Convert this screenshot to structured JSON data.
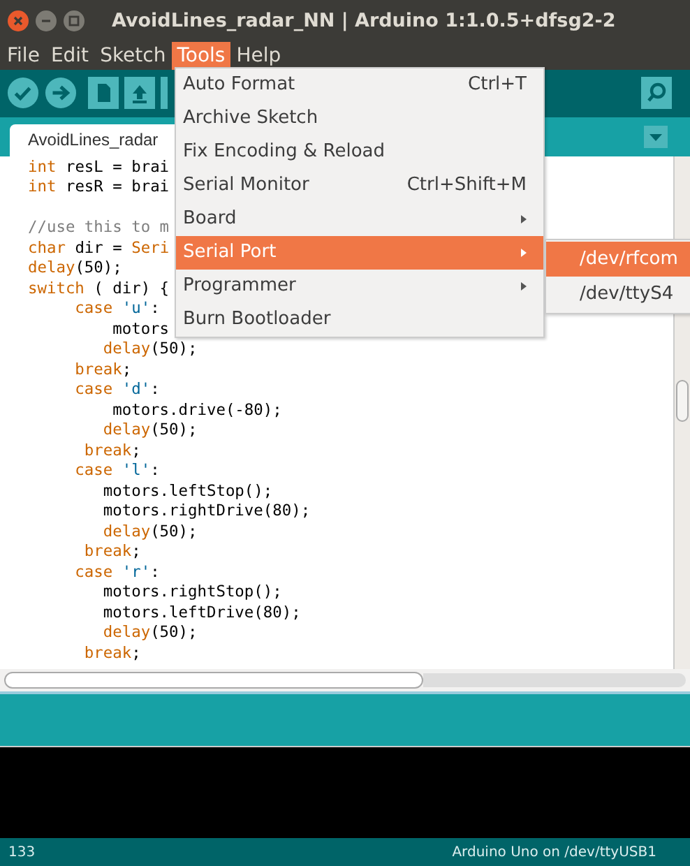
{
  "window": {
    "title": "AvoidLines_radar_NN | Arduino 1:1.0.5+dfsg2-2"
  },
  "menubar": [
    {
      "label": "File",
      "selected": false
    },
    {
      "label": "Edit",
      "selected": false
    },
    {
      "label": "Sketch",
      "selected": false
    },
    {
      "label": "Tools",
      "selected": true
    },
    {
      "label": "Help",
      "selected": false
    }
  ],
  "tabs": [
    {
      "label": "AvoidLines_radar",
      "selected": true
    }
  ],
  "editor": {
    "lines": [
      [
        {
          "kind": "keyword",
          "text": "int"
        },
        {
          "kind": "plain",
          "text": " resL = brai"
        }
      ],
      [
        {
          "kind": "keyword",
          "text": "int"
        },
        {
          "kind": "plain",
          "text": " resR = brai"
        }
      ],
      [
        {
          "kind": "blank"
        }
      ],
      [
        {
          "kind": "comment",
          "text": "//use this to m"
        }
      ],
      [
        {
          "kind": "keyword",
          "text": "char"
        },
        {
          "kind": "plain",
          "text": " dir = "
        },
        {
          "kind": "keyword",
          "text": "Seri"
        }
      ],
      [
        {
          "kind": "keyword",
          "text": "delay"
        },
        {
          "kind": "plain",
          "text": "(50);"
        }
      ],
      [
        {
          "kind": "keyword",
          "text": "switch"
        },
        {
          "kind": "plain",
          "text": " ( dir) {"
        }
      ],
      [
        {
          "kind": "keyword",
          "text": "     case"
        },
        {
          "kind": "string",
          "text": " 'u'"
        },
        {
          "kind": "plain",
          "text": ":"
        }
      ],
      [
        {
          "kind": "plain",
          "text": "         motors"
        }
      ],
      [
        {
          "kind": "keyword",
          "text": "        delay"
        },
        {
          "kind": "plain",
          "text": "(50);"
        }
      ],
      [
        {
          "kind": "keyword",
          "text": "     break"
        },
        {
          "kind": "plain",
          "text": ";"
        }
      ],
      [
        {
          "kind": "keyword",
          "text": "     case"
        },
        {
          "kind": "string",
          "text": " 'd'"
        },
        {
          "kind": "plain",
          "text": ":"
        }
      ],
      [
        {
          "kind": "plain",
          "text": "         motors.drive(-80);"
        }
      ],
      [
        {
          "kind": "keyword",
          "text": "        delay"
        },
        {
          "kind": "plain",
          "text": "(50);"
        }
      ],
      [
        {
          "kind": "keyword",
          "text": "      break"
        },
        {
          "kind": "plain",
          "text": ";"
        }
      ],
      [
        {
          "kind": "keyword",
          "text": "     case"
        },
        {
          "kind": "string",
          "text": " 'l'"
        },
        {
          "kind": "plain",
          "text": ":"
        }
      ],
      [
        {
          "kind": "plain",
          "text": "        motors.leftStop();"
        }
      ],
      [
        {
          "kind": "plain",
          "text": "        motors.rightDrive(80);"
        }
      ],
      [
        {
          "kind": "keyword",
          "text": "        delay"
        },
        {
          "kind": "plain",
          "text": "(50);"
        }
      ],
      [
        {
          "kind": "keyword",
          "text": "      break"
        },
        {
          "kind": "plain",
          "text": ";"
        }
      ],
      [
        {
          "kind": "keyword",
          "text": "     case"
        },
        {
          "kind": "string",
          "text": " 'r'"
        },
        {
          "kind": "plain",
          "text": ":"
        }
      ],
      [
        {
          "kind": "plain",
          "text": "        motors.rightStop();"
        }
      ],
      [
        {
          "kind": "plain",
          "text": "        motors.leftDrive(80);"
        }
      ],
      [
        {
          "kind": "keyword",
          "text": "        delay"
        },
        {
          "kind": "plain",
          "text": "(50);"
        }
      ],
      [
        {
          "kind": "keyword",
          "text": "      break"
        },
        {
          "kind": "plain",
          "text": ";"
        }
      ]
    ]
  },
  "tools_menu": [
    {
      "label": "Auto Format",
      "shortcut": "Ctrl+T",
      "submenu": false,
      "selected": false
    },
    {
      "label": "Archive Sketch",
      "submenu": false,
      "selected": false
    },
    {
      "label": "Fix Encoding & Reload",
      "submenu": false,
      "selected": false
    },
    {
      "label": "Serial Monitor",
      "shortcut": "Ctrl+Shift+M",
      "submenu": false,
      "selected": false
    },
    {
      "label": "Board",
      "submenu": true,
      "selected": false
    },
    {
      "label": "Serial Port",
      "submenu": true,
      "selected": true
    },
    {
      "label": "Programmer",
      "submenu": true,
      "selected": false
    },
    {
      "label": "Burn Bootloader",
      "submenu": false,
      "selected": false
    }
  ],
  "serial_port_menu": [
    {
      "label": "/dev/rfcom",
      "selected": true
    },
    {
      "label": "/dev/ttyS4",
      "selected": false
    }
  ],
  "status_bar": {
    "line": "133",
    "board": "Arduino Uno on /dev/ttyUSB1"
  }
}
